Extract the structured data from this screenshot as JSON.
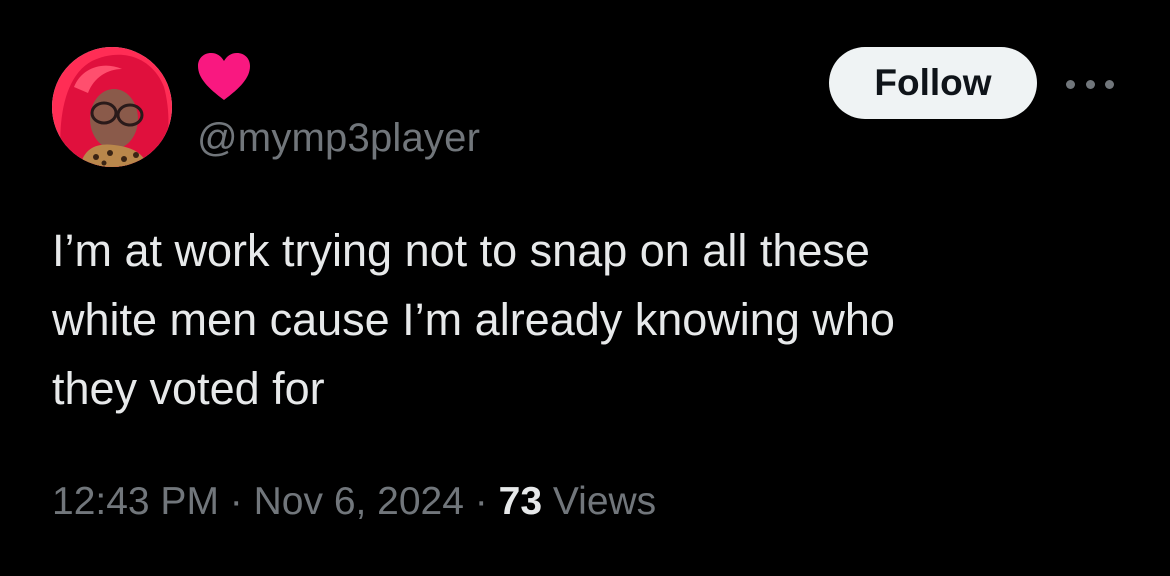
{
  "user": {
    "handle": "@mymp3player",
    "display_name_icon": "heart-icon",
    "heart_color": "#f91880",
    "avatar_icon": "profile-photo"
  },
  "actions": {
    "follow_label": "Follow",
    "more_icon": "more-horizontal-icon"
  },
  "tweet": {
    "text": "I’m at work trying not to snap on all these\nwhite men cause I’m already knowing who\nthey voted for"
  },
  "meta": {
    "time": "12:43 PM",
    "separator": "·",
    "date": "Nov 6, 2024",
    "views_count": "73",
    "views_label": "Views"
  },
  "colors": {
    "background": "#000000",
    "text": "#e7e9ea",
    "secondary_text": "#71767b",
    "follow_bg": "#eff3f4",
    "follow_text": "#0f1419"
  }
}
